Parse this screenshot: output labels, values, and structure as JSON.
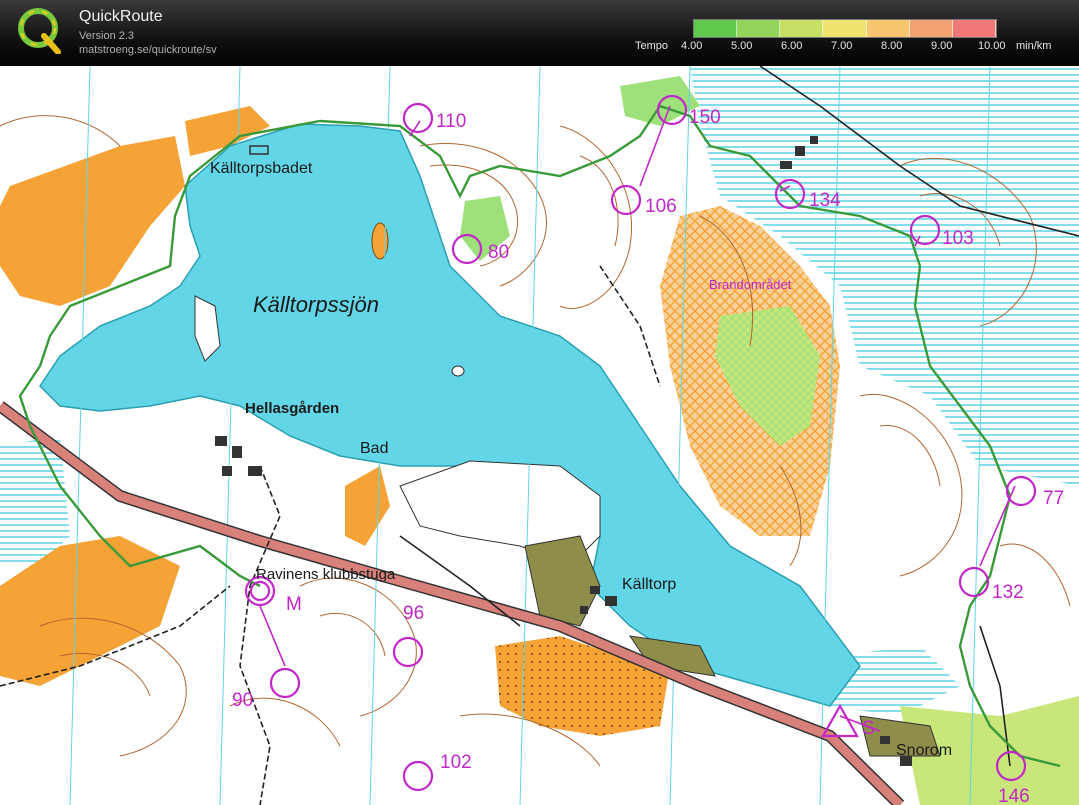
{
  "app": {
    "title": "QuickRoute",
    "version": "Version 2.3",
    "url": "matstroeng.se/quickroute/sv"
  },
  "tempo_scale": {
    "label": "Tempo",
    "ticks": [
      "4.00",
      "5.00",
      "6.00",
      "7.00",
      "8.00",
      "9.00",
      "10.00"
    ],
    "unit": "min/km",
    "colors": [
      "#5fc84d",
      "#94d45a",
      "#c8df66",
      "#efe36f",
      "#f7c56d",
      "#f3a272",
      "#f07878"
    ]
  },
  "map": {
    "colors": {
      "water": "#62d6e6",
      "open_land": "#f5a236",
      "rough_open": "#f8d29a",
      "forest": "#ffffff",
      "green": "#9ee07a",
      "contour": "#b06632",
      "course": "#c227c8",
      "route": "#3a9a3a",
      "road": "#d8807a",
      "building": "#333333",
      "cultivated": "#8e8e4a"
    },
    "place_names": [
      {
        "id": "kalltorpsbadet",
        "text": "Källtorpsbadet"
      },
      {
        "id": "kalltorpssjon",
        "text": "Källtorpssjön"
      },
      {
        "id": "hellasgarden",
        "text": "Hellasgården"
      },
      {
        "id": "bad",
        "text": "Bad"
      },
      {
        "id": "ravinens",
        "text": "Ravinens klubbstuga"
      },
      {
        "id": "kalltorp",
        "text": "Källtorp"
      },
      {
        "id": "brandomradet",
        "text": "Brandområdet"
      },
      {
        "id": "snorom",
        "text": "Snorom"
      }
    ],
    "controls": [
      {
        "id": "110",
        "label": "110"
      },
      {
        "id": "150",
        "label": "150"
      },
      {
        "id": "106",
        "label": "106"
      },
      {
        "id": "134",
        "label": "134"
      },
      {
        "id": "103",
        "label": "103"
      },
      {
        "id": "80",
        "label": "80"
      },
      {
        "id": "77",
        "label": "77"
      },
      {
        "id": "132",
        "label": "132"
      },
      {
        "id": "96",
        "label": "96"
      },
      {
        "id": "90",
        "label": "90"
      },
      {
        "id": "102",
        "label": "102"
      },
      {
        "id": "146",
        "label": "146"
      },
      {
        "id": "m",
        "label": "M"
      },
      {
        "id": "s",
        "label": "S"
      }
    ]
  }
}
